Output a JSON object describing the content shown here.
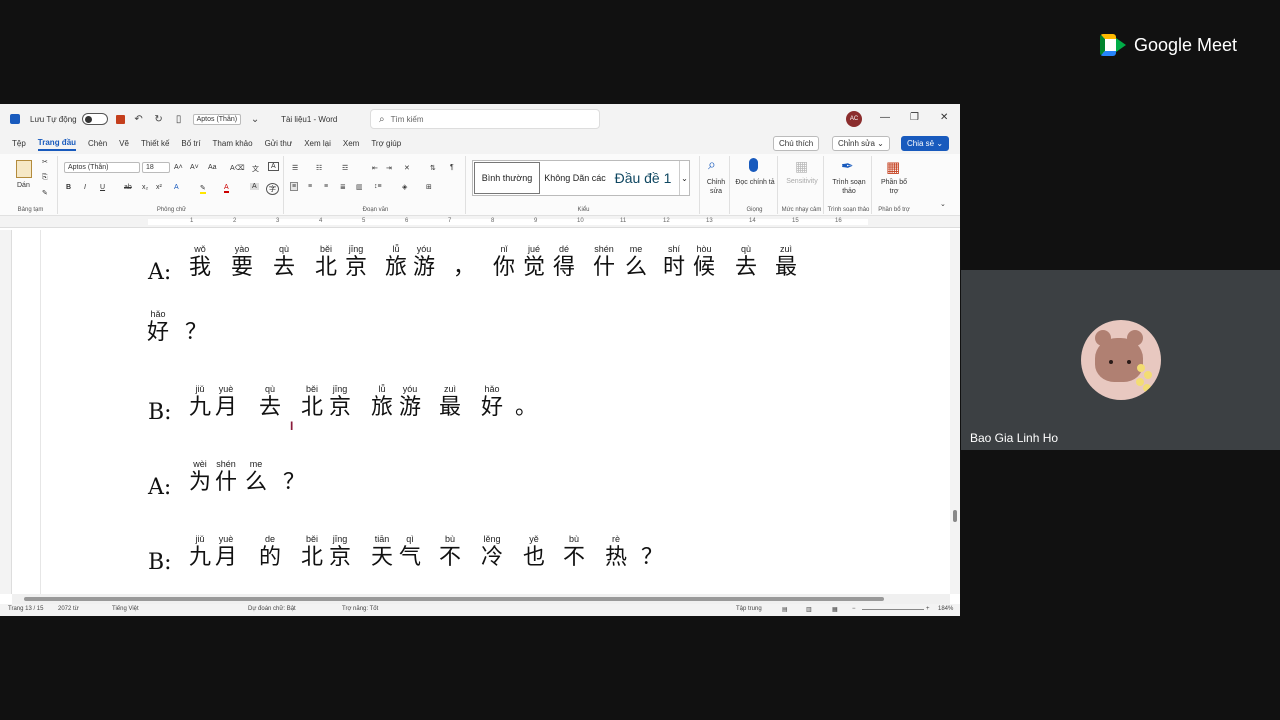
{
  "meet": {
    "brand": "Google Meet",
    "participant_name": "Bao Gia Linh Ho"
  },
  "word": {
    "autosave_label": "Lưu Tự động",
    "qat_font": "Aptos (Thân)",
    "doc_title": "Tài liệu1 - Word",
    "search_placeholder": "Tìm kiếm",
    "user_initials": "AC",
    "tabs": [
      "Tệp",
      "Trang đầu",
      "Chèn",
      "Vẽ",
      "Thiết kế",
      "Bố trí",
      "Tham khảo",
      "Gửi thư",
      "Xem lại",
      "Xem",
      "Trợ giúp"
    ],
    "active_tab": "Trang đầu",
    "comment_btn": "Chú thích",
    "edit_btn": "Chỉnh sửa",
    "share_btn": "Chia sẻ",
    "ribbon": {
      "paste_label": "Dán",
      "clipboard_group": "Bảng tạm",
      "font_name": "Aptos (Thân)",
      "font_size": "18",
      "font_group": "Phông chữ",
      "paragraph_group": "Đoạn văn",
      "style_normal": "Bình thường",
      "style_nospacing": "Không Dãn các",
      "style_heading1": "Đầu đề 1",
      "styles_group": "Kiểu",
      "editing_label": "Chỉnh sửa",
      "dictate_label": "Đọc chính tả",
      "voice_group": "Giọng",
      "sensitivity_label": "Sensitivity",
      "sensitivity_group": "Mức nhạy cảm",
      "editor_label": "Trình soạn thảo",
      "editor_group": "Trình soạn thảo",
      "addins_label": "Phần bổ trợ",
      "addins_group": "Phần bổ trợ"
    },
    "ruler_numbers": [
      "1",
      "2",
      "3",
      "4",
      "5",
      "6",
      "7",
      "8",
      "9",
      "10",
      "11",
      "12",
      "13",
      "14",
      "15",
      "16"
    ],
    "status": {
      "page": "Trang 13 / 15",
      "words": "2072 từ",
      "language": "Tiếng Việt",
      "prediction": "Dự đoán chữ: Bật",
      "accessibility": "Trợ năng: Tốt",
      "focus": "Tập trung",
      "zoom": "184%"
    }
  },
  "dialogue": [
    {
      "speaker": "A:",
      "chars": [
        {
          "py": "wǒ",
          "hz": "我"
        },
        {
          "py": "yào",
          "hz": "要"
        },
        {
          "py": "qù",
          "hz": "去"
        },
        {
          "py": "běi",
          "hz": "北"
        },
        {
          "py": "jīng",
          "hz": "京"
        },
        {
          "py": "lǚ",
          "hz": "旅"
        },
        {
          "py": "yóu",
          "hz": "游"
        },
        {
          "py": "",
          "hz": "，"
        },
        {
          "py": "nǐ",
          "hz": "你"
        },
        {
          "py": "jué",
          "hz": "觉"
        },
        {
          "py": "dé",
          "hz": "得"
        },
        {
          "py": "shén",
          "hz": "什"
        },
        {
          "py": "me",
          "hz": "么"
        },
        {
          "py": "shí",
          "hz": "时"
        },
        {
          "py": "hòu",
          "hz": "候"
        },
        {
          "py": "qù",
          "hz": "去"
        },
        {
          "py": "zuì",
          "hz": "最"
        }
      ]
    },
    {
      "speaker": "",
      "chars": [
        {
          "py": "hǎo",
          "hz": "好"
        },
        {
          "py": "",
          "hz": "？"
        }
      ]
    },
    {
      "speaker": "B:",
      "chars": [
        {
          "py": "jiǔ",
          "hz": "九"
        },
        {
          "py": "yuè",
          "hz": "月"
        },
        {
          "py": "qù",
          "hz": "去"
        },
        {
          "py": "běi",
          "hz": "北"
        },
        {
          "py": "jīng",
          "hz": "京"
        },
        {
          "py": "lǚ",
          "hz": "旅"
        },
        {
          "py": "yóu",
          "hz": "游"
        },
        {
          "py": "zuì",
          "hz": "最"
        },
        {
          "py": "hǎo",
          "hz": "好"
        },
        {
          "py": "",
          "hz": "。"
        }
      ]
    },
    {
      "speaker": "A:",
      "chars": [
        {
          "py": "wèi",
          "hz": "为"
        },
        {
          "py": "shén",
          "hz": "什"
        },
        {
          "py": "me",
          "hz": "么"
        },
        {
          "py": "",
          "hz": "？"
        }
      ]
    },
    {
      "speaker": "B:",
      "chars": [
        {
          "py": "jiǔ",
          "hz": "九"
        },
        {
          "py": "yuè",
          "hz": "月"
        },
        {
          "py": "de",
          "hz": "的"
        },
        {
          "py": "běi",
          "hz": "北"
        },
        {
          "py": "jīng",
          "hz": "京"
        },
        {
          "py": "tiān",
          "hz": "天"
        },
        {
          "py": "qì",
          "hz": "气"
        },
        {
          "py": "bù",
          "hz": "不"
        },
        {
          "py": "lěng",
          "hz": "冷"
        },
        {
          "py": "yě",
          "hz": "也"
        },
        {
          "py": "bù",
          "hz": "不"
        },
        {
          "py": "rè",
          "hz": "热"
        },
        {
          "py": "",
          "hz": "？"
        }
      ]
    }
  ]
}
